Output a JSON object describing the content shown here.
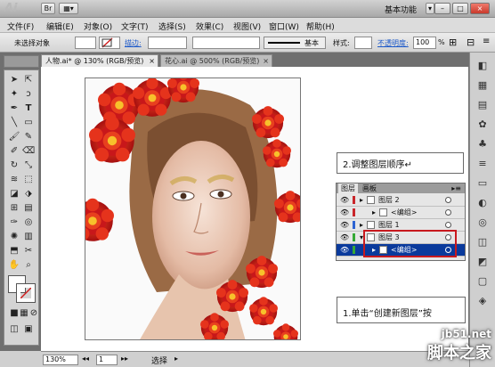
{
  "app": {
    "logo": "Ai",
    "workspace": "基本功能",
    "window_buttons": [
      "–",
      "□",
      "×"
    ]
  },
  "menu": [
    "文件(F)",
    "编辑(E)",
    "对象(O)",
    "文字(T)",
    "选择(S)",
    "效果(C)",
    "视图(V)",
    "窗口(W)",
    "帮助(H)"
  ],
  "control_bar": {
    "selection_label": "未选择对象",
    "stroke_label": "描边:",
    "stroke_style": "基本",
    "style_label": "样式:",
    "opacity_label": "不透明度:",
    "opacity_value": "100",
    "opacity_unit": "%"
  },
  "tabs": [
    {
      "label": "人物.ai* @ 130% (RGB/预览)"
    },
    {
      "label": "花心.ai @ 500% (RGB/预览)"
    }
  ],
  "notes": {
    "step2": "2.调整图层顺序↵",
    "step1": "1.单击“创建新图层”按"
  },
  "layers_panel": {
    "tabs": [
      "图层",
      "画板"
    ],
    "rows": [
      {
        "name": "图层 2",
        "indent": 0,
        "bar_color": "#c9252a",
        "selected": false
      },
      {
        "name": "<编组>",
        "indent": 1,
        "bar_color": "#c9252a",
        "selected": false
      },
      {
        "name": "图层 1",
        "indent": 0,
        "bar_color": "#2d63d2",
        "selected": false
      },
      {
        "name": "图层 3",
        "indent": 0,
        "bar_color": "#35a935",
        "selected": false
      },
      {
        "name": "<编组>",
        "indent": 1,
        "bar_color": "#35a935",
        "selected": true
      }
    ]
  },
  "status": {
    "zoom": "130%",
    "page": "1",
    "mode": "选择"
  },
  "watermark": {
    "site": "jb51.net",
    "name": "脚本之家"
  },
  "colors": {
    "highlight_red": "#c8191e",
    "selection_blue": "#0a3a9c",
    "flower_red": "#d8231b"
  }
}
